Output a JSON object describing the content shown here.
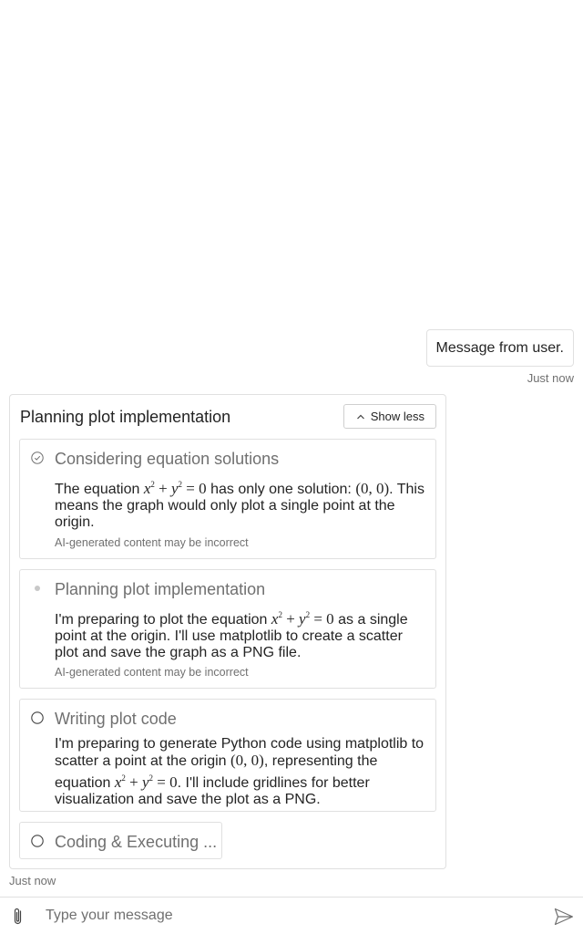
{
  "user_message": {
    "text": "Message from user.",
    "time": "Just now"
  },
  "bot_message": {
    "title": "Planning plot implementation",
    "toggle_label": "Show less",
    "time": "Just now",
    "steps": [
      {
        "status": "completed",
        "title": "Considering equation solutions",
        "body_1": "The equation",
        "body_2": "has only one solution:",
        "body_3": ". This means the graph would only plot a single point at the origin.",
        "note": "AI-generated content may be incorrect"
      },
      {
        "status": "in-progress",
        "title": "Planning plot implementation",
        "body_1": "I'm preparing to plot the equation",
        "body_2": "as a single point at the origin. I'll use matplotlib to create a scatter plot and save the graph as a PNG file.",
        "note": "AI-generated content may be incorrect"
      },
      {
        "status": "pending",
        "title": "Writing plot code",
        "body_1": "I'm preparing to generate Python code using matplotlib to scatter a point at the origin",
        "body_2": ", representing the equation",
        "body_3": ". I'll include gridlines for better visualization and save the plot as a PNG."
      },
      {
        "status": "pending",
        "title": "Coding & Executing ..."
      }
    ],
    "math": {
      "x": "x",
      "y": "y",
      "exp": "2",
      "plus": "+",
      "equals_zero": "= 0",
      "origin": "(0, 0)"
    }
  },
  "composer": {
    "placeholder": "Type your message",
    "attach_icon": "paperclip-icon",
    "send_icon": "send-icon"
  },
  "colors": {
    "text": "#242424",
    "muted": "#707070",
    "border": "#e0e0e0"
  }
}
